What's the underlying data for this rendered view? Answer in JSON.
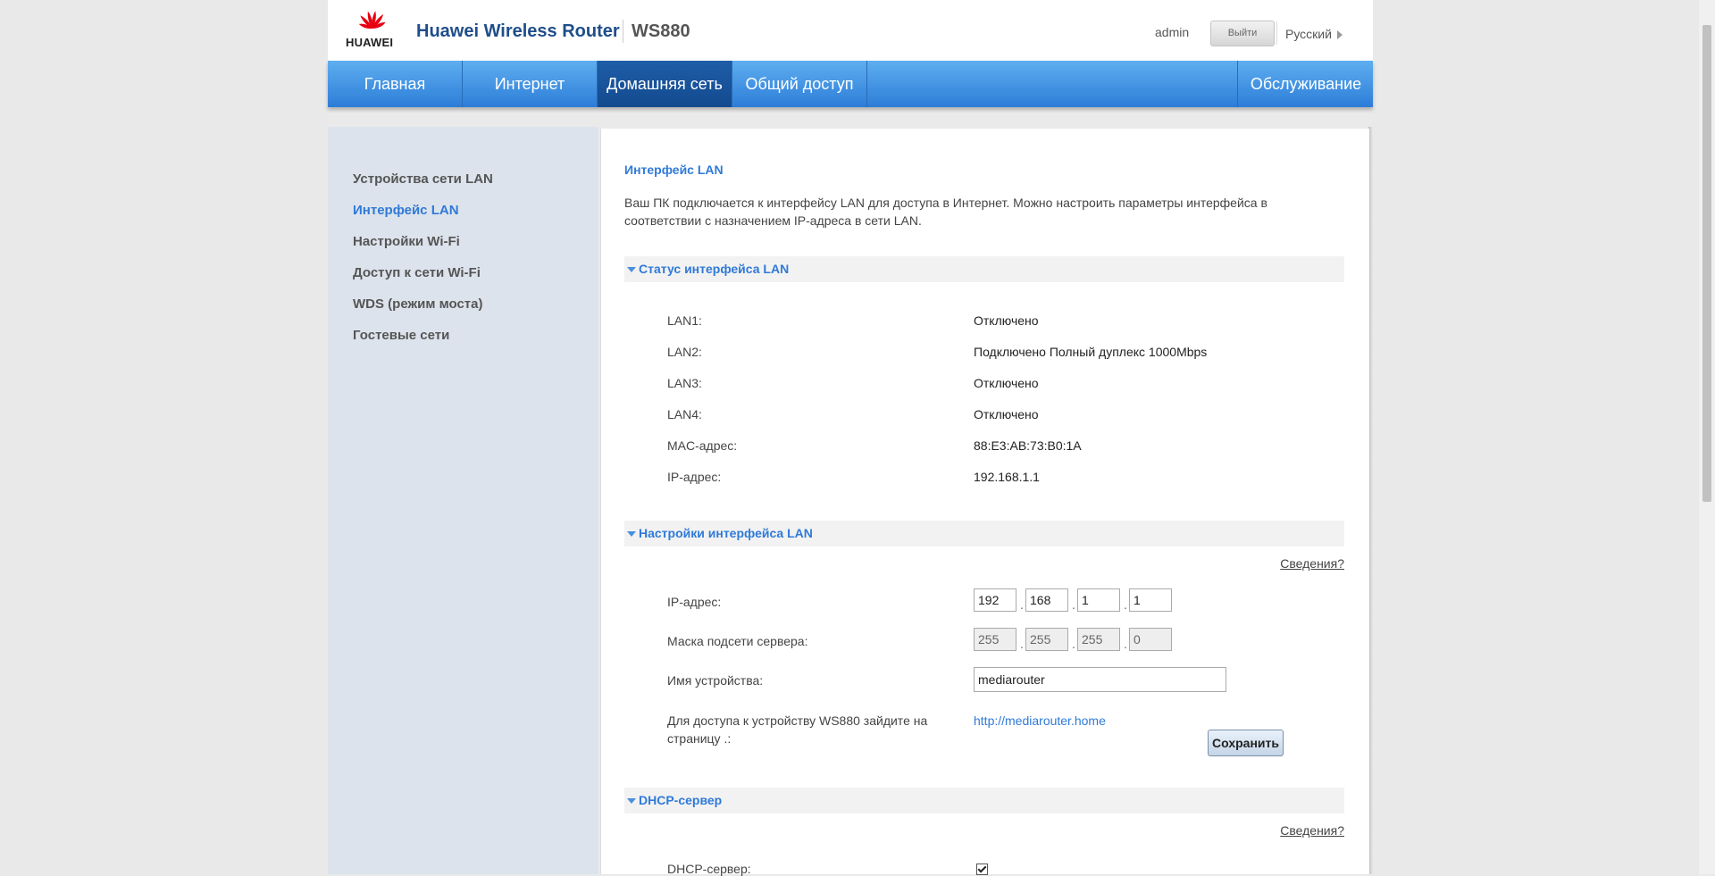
{
  "header": {
    "logo_text": "HUAWEI",
    "brand": "Huawei Wireless Router",
    "model": "WS880",
    "user": "admin",
    "logout_label": "Выйти",
    "language": "Русский"
  },
  "nav": {
    "items": [
      "Главная",
      "Интернет",
      "Домашняя сеть",
      "Общий доступ"
    ],
    "right_item": "Обслуживание",
    "active": "Домашняя сеть"
  },
  "sidebar": {
    "items": [
      "Устройства сети LAN",
      "Интерфейс LAN",
      "Настройки Wi-Fi",
      "Доступ к сети Wi-Fi",
      "WDS (режим моста)",
      "Гостевые сети"
    ],
    "active": "Интерфейс LAN"
  },
  "content": {
    "title": "Интерфейс LAN",
    "description": "Ваш ПК подключается к интерфейсу LAN для доступа в Интернет. Можно настроить параметры интерфейса в соответствии с назначением IP-адреса в сети LAN.",
    "status_section": {
      "title": "Статус интерфейса LAN",
      "rows": [
        {
          "label": "LAN1:",
          "value": "Отключено"
        },
        {
          "label": "LAN2:",
          "value": "Подключено Полный дуплекс 1000Mbps"
        },
        {
          "label": "LAN3:",
          "value": "Отключено"
        },
        {
          "label": "LAN4:",
          "value": "Отключено"
        },
        {
          "label": "MAC-адрес:",
          "value": "88:E3:AB:73:B0:1A"
        },
        {
          "label": "IP-адрес:",
          "value": "192.168.1.1"
        }
      ]
    },
    "settings_section": {
      "title": "Настройки интерфейса LAN",
      "help": "Сведения?",
      "ip_label": "IP-адрес:",
      "ip": [
        "192",
        "168",
        "1",
        "1"
      ],
      "mask_label": "Маска подсети сервера:",
      "mask": [
        "255",
        "255",
        "255",
        "0"
      ],
      "device_name_label": "Имя устройства:",
      "device_name": "mediarouter",
      "access_label": "Для доступа к устройству WS880 зайдите на страницу .:",
      "access_link": "http://mediarouter.home",
      "save_label": "Сохранить"
    },
    "dhcp_section": {
      "title": "DHCP-сервер",
      "help": "Сведения?",
      "dhcp_label": "DHCP-сервер:",
      "dhcp_enabled": true
    }
  },
  "colors": {
    "accent": "#2f7ad8",
    "nav_active": "#1e5da8",
    "brand": "#1f4e8a",
    "logo_red": "#e60012"
  }
}
